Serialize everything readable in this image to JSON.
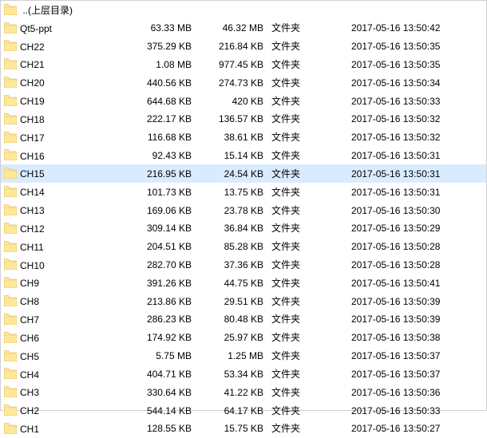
{
  "parent": {
    "name": "..(上层目录)"
  },
  "type_label": "文件夹",
  "rows": [
    {
      "name": "Qt5-ppt",
      "size1": "63.33 MB",
      "size2": "46.32 MB",
      "date": "2017-05-16 13:50:42",
      "selected": false
    },
    {
      "name": "CH22",
      "size1": "375.29 KB",
      "size2": "216.84 KB",
      "date": "2017-05-16 13:50:35",
      "selected": false
    },
    {
      "name": "CH21",
      "size1": "1.08 MB",
      "size2": "977.45 KB",
      "date": "2017-05-16 13:50:35",
      "selected": false
    },
    {
      "name": "CH20",
      "size1": "440.56 KB",
      "size2": "274.73 KB",
      "date": "2017-05-16 13:50:34",
      "selected": false
    },
    {
      "name": "CH19",
      "size1": "644.68 KB",
      "size2": "420 KB",
      "date": "2017-05-16 13:50:33",
      "selected": false
    },
    {
      "name": "CH18",
      "size1": "222.17 KB",
      "size2": "136.57 KB",
      "date": "2017-05-16 13:50:32",
      "selected": false
    },
    {
      "name": "CH17",
      "size1": "116.68 KB",
      "size2": "38.61 KB",
      "date": "2017-05-16 13:50:32",
      "selected": false
    },
    {
      "name": "CH16",
      "size1": "92.43 KB",
      "size2": "15.14 KB",
      "date": "2017-05-16 13:50:31",
      "selected": false
    },
    {
      "name": "CH15",
      "size1": "216.95 KB",
      "size2": "24.54 KB",
      "date": "2017-05-16 13:50:31",
      "selected": true
    },
    {
      "name": "CH14",
      "size1": "101.73 KB",
      "size2": "13.75 KB",
      "date": "2017-05-16 13:50:31",
      "selected": false
    },
    {
      "name": "CH13",
      "size1": "169.06 KB",
      "size2": "23.78 KB",
      "date": "2017-05-16 13:50:30",
      "selected": false
    },
    {
      "name": "CH12",
      "size1": "309.14 KB",
      "size2": "36.84 KB",
      "date": "2017-05-16 13:50:29",
      "selected": false
    },
    {
      "name": "CH11",
      "size1": "204.51 KB",
      "size2": "85.28 KB",
      "date": "2017-05-16 13:50:28",
      "selected": false
    },
    {
      "name": "CH10",
      "size1": "282.70 KB",
      "size2": "37.36 KB",
      "date": "2017-05-16 13:50:28",
      "selected": false
    },
    {
      "name": "CH9",
      "size1": "391.26 KB",
      "size2": "44.75 KB",
      "date": "2017-05-16 13:50:41",
      "selected": false
    },
    {
      "name": "CH8",
      "size1": "213.86 KB",
      "size2": "29.51 KB",
      "date": "2017-05-16 13:50:39",
      "selected": false
    },
    {
      "name": "CH7",
      "size1": "286.23 KB",
      "size2": "80.48 KB",
      "date": "2017-05-16 13:50:39",
      "selected": false
    },
    {
      "name": "CH6",
      "size1": "174.92 KB",
      "size2": "25.97 KB",
      "date": "2017-05-16 13:50:38",
      "selected": false
    },
    {
      "name": "CH5",
      "size1": "5.75 MB",
      "size2": "1.25 MB",
      "date": "2017-05-16 13:50:37",
      "selected": false
    },
    {
      "name": "CH4",
      "size1": "404.71 KB",
      "size2": "53.34 KB",
      "date": "2017-05-16 13:50:37",
      "selected": false
    },
    {
      "name": "CH3",
      "size1": "330.64 KB",
      "size2": "41.22 KB",
      "date": "2017-05-16 13:50:36",
      "selected": false
    },
    {
      "name": "CH2",
      "size1": "544.14 KB",
      "size2": "64.17 KB",
      "date": "2017-05-16 13:50:33",
      "selected": false
    },
    {
      "name": "CH1",
      "size1": "128.55 KB",
      "size2": "15.75 KB",
      "date": "2017-05-16 13:50:27",
      "selected": false
    }
  ]
}
